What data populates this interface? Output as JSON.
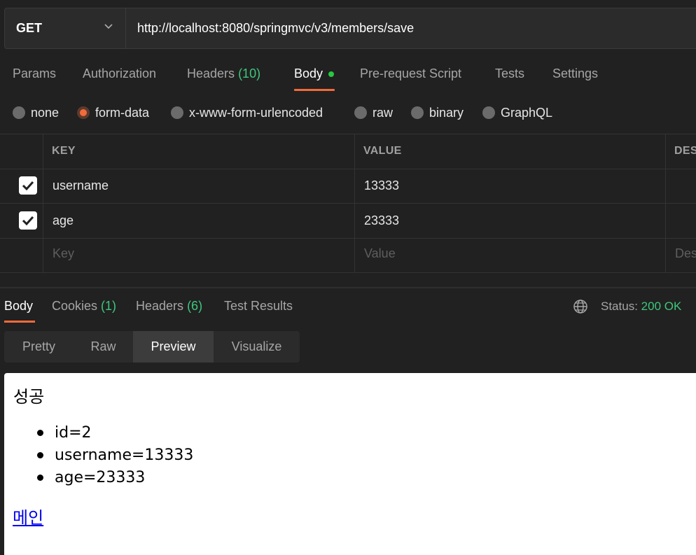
{
  "request": {
    "method": "GET",
    "url": "http://localhost:8080/springmvc/v3/members/save",
    "tabs": {
      "params": "Params",
      "authorization": "Authorization",
      "headers_label": "Headers",
      "headers_count": "(10)",
      "body": "Body",
      "prerequest": "Pre-request Script",
      "tests": "Tests",
      "settings": "Settings"
    },
    "body_types": {
      "none": "none",
      "form_data": "form-data",
      "urlencoded": "x-www-form-urlencoded",
      "raw": "raw",
      "binary": "binary",
      "graphql": "GraphQL"
    },
    "selected_body_type": "form-data",
    "table": {
      "headers": {
        "key": "KEY",
        "value": "VALUE",
        "desc": "DES"
      },
      "rows": [
        {
          "checked": true,
          "key": "username",
          "value": "13333"
        },
        {
          "checked": true,
          "key": "age",
          "value": "23333"
        }
      ],
      "placeholder": {
        "key": "Key",
        "value": "Value",
        "desc": "Des"
      }
    }
  },
  "response": {
    "tabs": {
      "body": "Body",
      "cookies_label": "Cookies",
      "cookies_count": "(1)",
      "headers_label": "Headers",
      "headers_count": "(6)",
      "tests": "Test Results"
    },
    "status_label": "Status:",
    "status_value": "200 OK",
    "views": {
      "pretty": "Pretty",
      "raw": "Raw",
      "preview": "Preview",
      "visualize": "Visualize"
    },
    "active_view": "Preview",
    "preview": {
      "title": "성공",
      "items": [
        "id=2",
        "username=13333",
        "age=23333"
      ],
      "link": "메인"
    }
  },
  "colors": {
    "accent": "#f26b3a",
    "success": "#3ec77b",
    "background": "#212121"
  }
}
